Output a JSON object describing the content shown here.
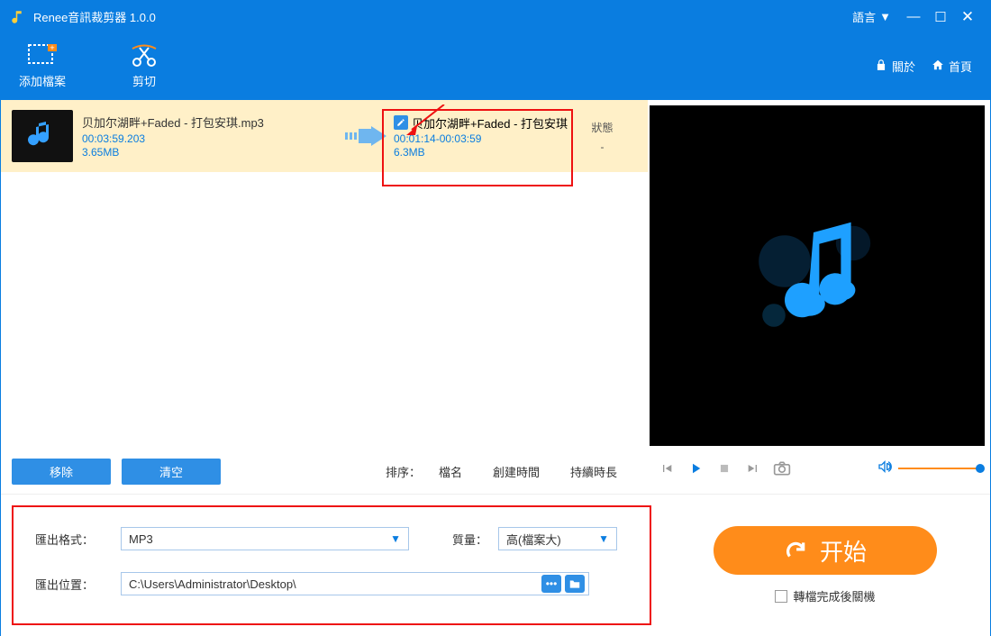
{
  "titlebar": {
    "app_name": "Renee音訊裁剪器 1.0.0",
    "lang_label": "語言"
  },
  "toolbar": {
    "add_file": "添加檔案",
    "cut": "剪切",
    "about": "關於",
    "home": "首頁"
  },
  "file": {
    "in_name": "贝加尔湖畔+Faded - 打包安琪.mp3",
    "in_dur": "00:03:59.203",
    "in_size": "3.65MB",
    "out_name": "贝加尔湖畔+Faded - 打包安琪",
    "out_range": "00:01:14-00:03:59",
    "out_size": "6.3MB",
    "status_hdr": "狀態",
    "status_val": "-"
  },
  "list_footer": {
    "remove": "移除",
    "clear": "清空",
    "sort_label": "排序：",
    "sort_name": "檔名",
    "sort_created": "創建時間",
    "sort_duration": "持續時長"
  },
  "settings": {
    "format_label": "匯出格式：",
    "format_value": "MP3",
    "quality_label": "質量：",
    "quality_value": "高(檔案大)",
    "path_label": "匯出位置：",
    "path_value": "C:\\Users\\Administrator\\Desktop\\"
  },
  "start": {
    "btn": "开始",
    "shutdown": "轉檔完成後關機"
  }
}
